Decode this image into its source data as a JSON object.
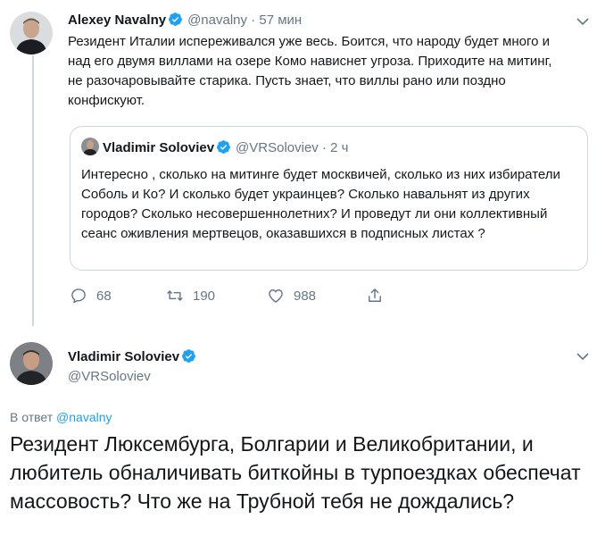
{
  "tweet": {
    "author_name": "Alexey Navalny",
    "author_handle": "@navalny",
    "separator": "·",
    "time": "57 мин",
    "text": "Резидент Италии испереживался уже весь. Боится, что народу будет много и над его двумя виллами на озере Комо нависнет угроза. Приходите на митинг, не разочаровывайте старика. Пусть знает, что виллы рано или поздно конфискуют.",
    "quote": {
      "author_name": "Vladimir Soloviev",
      "author_handle": "@VRSoloviev",
      "separator": "·",
      "time": "2 ч",
      "text": "Интересно , сколько на митинге будет москвичей, сколько из них избиратели Соболь и Ко? И сколько будет украинцев? Сколько навальнят из других городов? Сколько несовершеннолетних? И проведут ли они коллективный сеанс оживления мертвецов, оказавшихся в подписных листах ?"
    },
    "actions": {
      "replies": "68",
      "retweets": "190",
      "likes": "988"
    }
  },
  "reply": {
    "author_name": "Vladimir Soloviev",
    "author_handle": "@VRSoloviev",
    "reply_prefix": "В ответ",
    "reply_to": "@navalny",
    "text": "Резидент Люксембурга, Болгарии и Великобритании, и любитель обналичивать биткойны в турпоездках обеспечат массовость? Что же на Трубной тебя не дождались?"
  },
  "colors": {
    "accent": "#1da1f2",
    "muted": "#657786",
    "border": "#ccd6dd",
    "text": "#14171a"
  }
}
